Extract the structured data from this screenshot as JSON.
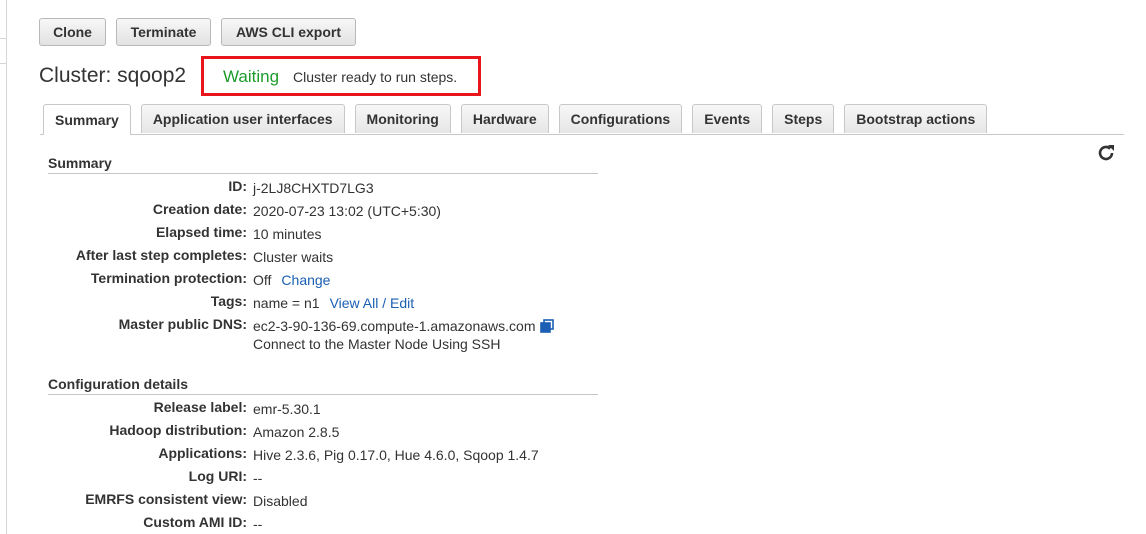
{
  "toolbar": {
    "clone": "Clone",
    "terminate": "Terminate",
    "cli_export": "AWS CLI export"
  },
  "cluster": {
    "title": "Cluster: sqoop2",
    "status": "Waiting",
    "status_detail": "Cluster ready to run steps."
  },
  "tabs": [
    "Summary",
    "Application user interfaces",
    "Monitoring",
    "Hardware",
    "Configurations",
    "Events",
    "Steps",
    "Bootstrap actions"
  ],
  "summary": {
    "heading": "Summary",
    "id_label": "ID:",
    "id_value": "j-2LJ8CHXTD7LG3",
    "creation_label": "Creation date:",
    "creation_value": "2020-07-23 13:02 (UTC+5:30)",
    "elapsed_label": "Elapsed time:",
    "elapsed_value": "10 minutes",
    "after_label": "After last step completes:",
    "after_value": "Cluster waits",
    "termination_label": "Termination protection:",
    "termination_value": "Off",
    "termination_link": "Change",
    "tags_label": "Tags:",
    "tags_value": "name = n1",
    "tags_link": "View All / Edit",
    "dns_label": "Master public DNS:",
    "dns_value": "ec2-3-90-136-69.compute-1.amazonaws.com",
    "ssh_link": "Connect to the Master Node Using SSH"
  },
  "config": {
    "heading": "Configuration details",
    "release_label": "Release label:",
    "release_value": "emr-5.30.1",
    "hadoop_label": "Hadoop distribution:",
    "hadoop_value": "Amazon 2.8.5",
    "apps_label": "Applications:",
    "apps_value": "Hive 2.3.6, Pig 0.17.0, Hue 4.6.0, Sqoop 1.4.7",
    "log_label": "Log URI:",
    "log_value": "--",
    "emrfs_label": "EMRFS consistent view:",
    "emrfs_value": "Disabled",
    "ami_label": "Custom AMI ID:",
    "ami_value": "--"
  },
  "colors": {
    "status_green": "#1d9c2c",
    "highlight_red": "#e8161b",
    "link_blue": "#1a5fb4"
  },
  "icons": {
    "refresh": "refresh-icon",
    "copy": "copy-icon"
  }
}
